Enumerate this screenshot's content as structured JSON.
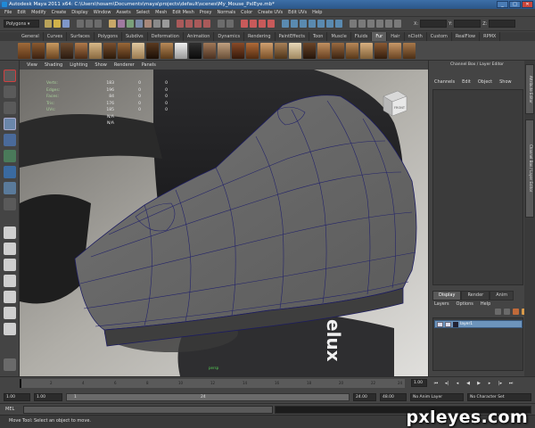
{
  "title_bar": {
    "text": "Autodesk Maya 2011 x64: C:\\Users\\hosam\\Documents\\maya\\projects\\default\\scenes\\My_Mouse_PxlEye.mb*",
    "minimize": "_",
    "maximize": "□",
    "close": "✕"
  },
  "menu": [
    "File",
    "Edit",
    "Modify",
    "Create",
    "Display",
    "Window",
    "Assets",
    "Select",
    "Mesh",
    "Edit Mesh",
    "Proxy",
    "Normals",
    "Color",
    "Create UVs",
    "Edit UVs",
    "Help"
  ],
  "status_line": {
    "mode": "Polygons",
    "x_label": "X:",
    "y_label": "Y:",
    "z_label": "Z:"
  },
  "shelf_tabs": [
    "General",
    "Curves",
    "Surfaces",
    "Polygons",
    "Subdivs",
    "Deformation",
    "Animation",
    "Dynamics",
    "Rendering",
    "PaintEffects",
    "Toon",
    "Muscle",
    "Fluids",
    "Fur",
    "Hair",
    "nCloth",
    "Custom",
    "RealFlow",
    "RPMX"
  ],
  "active_shelf_tab": "Fur",
  "viewport": {
    "menu": [
      "View",
      "Shading",
      "Lighting",
      "Show",
      "Renderer",
      "Panels"
    ],
    "hud": [
      {
        "label": "Verts:",
        "a": "183",
        "b": "0",
        "c": "0"
      },
      {
        "label": "Edges:",
        "a": "196",
        "b": "0",
        "c": "0"
      },
      {
        "label": "Faces:",
        "a": "84",
        "b": "0",
        "c": "0"
      },
      {
        "label": "Tris:",
        "a": "176",
        "b": "0",
        "c": "0"
      },
      {
        "label": "UVs:",
        "a": "185",
        "b": "0",
        "c": "0"
      },
      {
        "label": "",
        "a": "N/A",
        "b": "",
        "c": ""
      },
      {
        "label": "",
        "a": "N/A",
        "b": "",
        "c": ""
      }
    ],
    "camera_label": "persp",
    "viewcube_label": "FRONT",
    "text_on_mouse": "elux"
  },
  "channel_box": {
    "title": "Channel Box / Layer Editor",
    "menu": [
      "Channels",
      "Edit",
      "Object",
      "Show"
    ]
  },
  "layer_editor": {
    "tabs": [
      "Display",
      "Render",
      "Anim"
    ],
    "active_tab": "Display",
    "menu": [
      "Layers",
      "Options",
      "Help"
    ],
    "layer_name": "layer1",
    "layer_flag": "V"
  },
  "side_tabs": [
    "Attribute Editor",
    "Channel Box / Layer Editor"
  ],
  "time_slider": {
    "ticks": [
      "2",
      "4",
      "6",
      "8",
      "10",
      "12",
      "14",
      "16",
      "18",
      "20",
      "22",
      "24"
    ],
    "current_frame": "1.00"
  },
  "range_slider": {
    "start": "1.00",
    "start2": "1.00",
    "range_left": "1",
    "range_right": "24",
    "end": "24.00",
    "end2": "48.00",
    "anim_layer": "No Anim Layer",
    "character_set": "No Character Set"
  },
  "command_line": {
    "label": "MEL"
  },
  "help_line": "Move Tool: Select an object to move.",
  "watermark": "pxleyes.com"
}
